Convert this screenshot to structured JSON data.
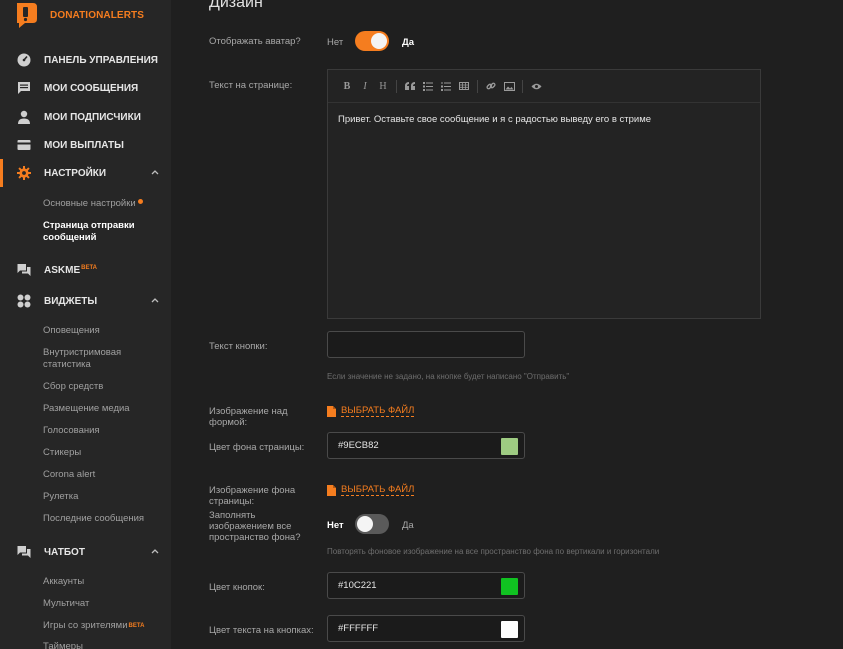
{
  "brand": {
    "name": "DONATIONALERTS"
  },
  "sidebar": {
    "main_items": [
      {
        "label": "ПАНЕЛЬ УПРАВЛЕНИЯ",
        "icon": "dashboard-icon"
      },
      {
        "label": "МОИ СООБЩЕНИЯ",
        "icon": "messages-icon"
      },
      {
        "label": "МОИ ПОДПИСЧИКИ",
        "icon": "user-icon"
      },
      {
        "label": "МОИ ВЫПЛАТЫ",
        "icon": "wallet-icon"
      },
      {
        "label": "НАСТРОЙКИ",
        "icon": "gear-icon"
      }
    ],
    "settings_sub": [
      {
        "label": "Основные настройки"
      },
      {
        "label": "Страница отправки"
      },
      {
        "label": "сообщений"
      }
    ],
    "askme": {
      "label": "ASKME",
      "badge": "BETA"
    },
    "widgets": {
      "label": "ВИДЖЕТЫ"
    },
    "widgets_sub": [
      {
        "label": "Оповещения"
      },
      {
        "label": "Внутристримовая"
      },
      {
        "label": "статистика"
      },
      {
        "label": "Сбор средств"
      },
      {
        "label": "Размещение медиа"
      },
      {
        "label": "Голосования"
      },
      {
        "label": "Стикеры"
      },
      {
        "label": "Corona alert"
      },
      {
        "label": "Рулетка"
      },
      {
        "label": "Последние сообщения"
      }
    ],
    "chatbot": {
      "label": "ЧАТБОТ"
    },
    "chatbot_sub": [
      {
        "label": "Аккаунты"
      },
      {
        "label": "Мультичат"
      },
      {
        "label": "Игры со зрителями",
        "badge": "BETA"
      },
      {
        "label": "Таймеры"
      }
    ]
  },
  "design": {
    "title": "Дизайн",
    "avatar": {
      "label": "Отображать аватар?",
      "off": "Нет",
      "on": "Да",
      "value": true
    },
    "page_text": {
      "label": "Текст на странице:",
      "value": "Привет. Оставьте свое сообщение и я с радостью выведу его в стриме",
      "toolbar": [
        "B",
        "I",
        "H"
      ]
    },
    "button_text": {
      "label": "Текст кнопки:",
      "value": "",
      "hint": "Если значение не задано, на кнопке будет написано \"Отправить\""
    },
    "form_image": {
      "label_1": "Изображение над",
      "label_2": "формой:",
      "button": "ВЫБРАТЬ ФАЙЛ"
    },
    "bg_color": {
      "label": "Цвет фона страницы:",
      "value": "#9ECB82",
      "swatch": "#9ECB82"
    },
    "bg_image": {
      "label_1": "Изображение фона",
      "label_2": "страницы:",
      "button": "ВЫБРАТЬ ФАЙЛ"
    },
    "fill": {
      "label_1": "Заполнять",
      "label_2": "изображением все",
      "label_3": "пространство фона?",
      "off": "Нет",
      "on": "Да",
      "value": false,
      "hint": "Повторять фоновое изображение на все пространство фона по вертикали и горизонтали"
    },
    "btn_color": {
      "label": "Цвет кнопок:",
      "value": "#10C221",
      "swatch": "#10C221"
    },
    "btn_text_color": {
      "label": "Цвет текста на кнопках:",
      "value": "#FFFFFF",
      "swatch": "#FFFFFF"
    }
  },
  "colors": {
    "accent": "#F57D1F",
    "toggle_on": "#F57D1F",
    "toggle_off": "#5A5A5A"
  }
}
